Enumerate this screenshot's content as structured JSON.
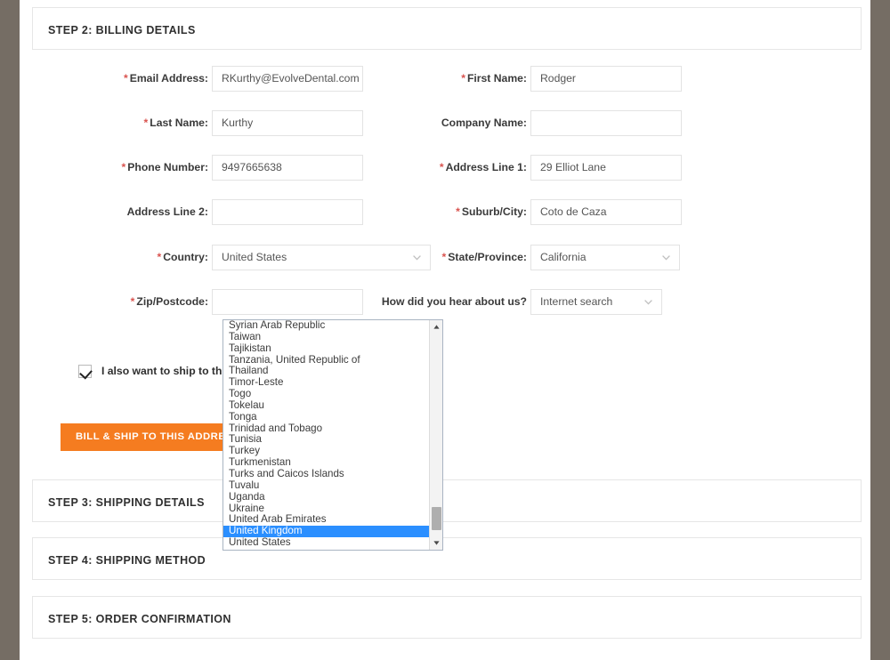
{
  "theme": {
    "accent_orange": "#f57c20",
    "required_red": "#d9534f",
    "highlight_blue": "#2b8fff",
    "edge_strip": "#756d64",
    "card_border": "#e6e6e6",
    "input_border": "#e3e3e3"
  },
  "steps": {
    "step2": "STEP 2: BILLING DETAILS",
    "step3": "STEP 3: SHIPPING DETAILS",
    "step4": "STEP 4: SHIPPING METHOD",
    "step5": "STEP 5: ORDER CONFIRMATION"
  },
  "form": {
    "email": {
      "label": "Email Address:",
      "required": "*",
      "value": "RKurthy@EvolveDental.com",
      "placeholder": ""
    },
    "first_name": {
      "label": "First Name:",
      "required": "*",
      "value": "Rodger",
      "placeholder": ""
    },
    "last_name": {
      "label": "Last Name:",
      "required": "*",
      "value": "Kurthy",
      "placeholder": ""
    },
    "company_name": {
      "label": "Company Name:",
      "required": "",
      "value": "",
      "placeholder": ""
    },
    "phone_number": {
      "label": "Phone Number:",
      "required": "*",
      "value": "9497665638",
      "placeholder": ""
    },
    "address_line_1": {
      "label": "Address Line 1:",
      "required": "*",
      "value": "29 Elliot Lane",
      "placeholder": ""
    },
    "address_line_2": {
      "label": "Address Line 2:",
      "required": "",
      "value": "",
      "placeholder": ""
    },
    "suburb_city": {
      "label": "Suburb/City:",
      "required": "*",
      "value": "Coto de Caza",
      "placeholder": ""
    },
    "country": {
      "label": "Country:",
      "required": "*",
      "value": "United States"
    },
    "state_province": {
      "label": "State/Province:",
      "required": "*",
      "value": "California"
    },
    "zip_postcode": {
      "label": "Zip/Postcode:",
      "required": "*",
      "value": "",
      "placeholder": ""
    },
    "hear_about_us": {
      "label": "How did you hear about us?",
      "required": "",
      "value": "Internet search"
    },
    "ship_checkbox": {
      "label": "I also want to ship to this address",
      "checked": true
    },
    "submit_button": "BILL & SHIP TO THIS ADDRESS"
  },
  "country_dropdown": {
    "open": true,
    "selected": "United Kingdom",
    "visible_options": [
      "Syrian Arab Republic",
      "Taiwan",
      "Tajikistan",
      "Tanzania, United Republic of",
      "Thailand",
      "Timor-Leste",
      "Togo",
      "Tokelau",
      "Tonga",
      "Trinidad and Tobago",
      "Tunisia",
      "Turkey",
      "Turkmenistan",
      "Turks and Caicos Islands",
      "Tuvalu",
      "Uganda",
      "Ukraine",
      "United Arab Emirates",
      "United Kingdom",
      "United States"
    ],
    "scroll_up_icon": "triangle-up-icon",
    "scroll_down_icon": "triangle-down-icon"
  }
}
